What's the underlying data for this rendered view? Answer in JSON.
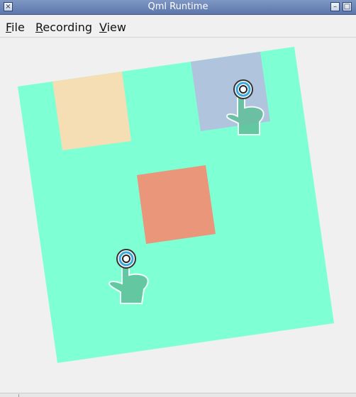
{
  "window": {
    "title": "Qml Runtime",
    "close_glyph": "×",
    "minimize_glyph": "–",
    "maximize_glyph": "□"
  },
  "menu": {
    "file": {
      "mnemonic": "F",
      "rest": "ile"
    },
    "recording": {
      "mnemonic": "R",
      "rest": "ecording"
    },
    "view": {
      "mnemonic": "V",
      "rest": "iew"
    }
  },
  "scene": {
    "colors": {
      "background": "#7fffd4",
      "tan_square": "#f5deb3",
      "blue_square": "#b0c4de",
      "salmon_square": "#e9967a",
      "touch_ring": "#39a8e0",
      "hand": "#5fbf99"
    },
    "touch_points": 2,
    "icons": [
      "touch-hand-icon",
      "touch-hand-icon"
    ]
  }
}
